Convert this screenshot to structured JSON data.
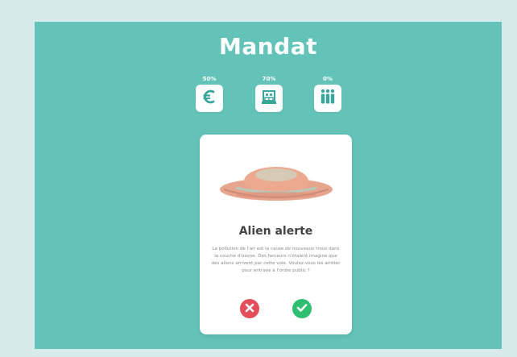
{
  "game": {
    "title": "Mandat"
  },
  "stats": [
    {
      "label": "50%",
      "icon": "euro-icon"
    },
    {
      "label": "70%",
      "icon": "institution-icon"
    },
    {
      "label": "0%",
      "icon": "people-icon"
    }
  ],
  "card": {
    "title": "Alien alerte",
    "text": "La pollution de l'air est la cause de nouveaux trous dans la couche d'ozone. Des farceurs n'étaient imaginé que des aliens arrivent par cette voie. Voulez-vous les arrêter pour entrave à l'ordre public ?",
    "image": "ufo-image"
  },
  "actions": {
    "reject_icon": "close-icon",
    "accept_icon": "check-icon"
  },
  "colors": {
    "background": "#63c3b9",
    "reject": "#e34d5c",
    "accept": "#2fbf71",
    "ufo": "#e8a58e"
  }
}
